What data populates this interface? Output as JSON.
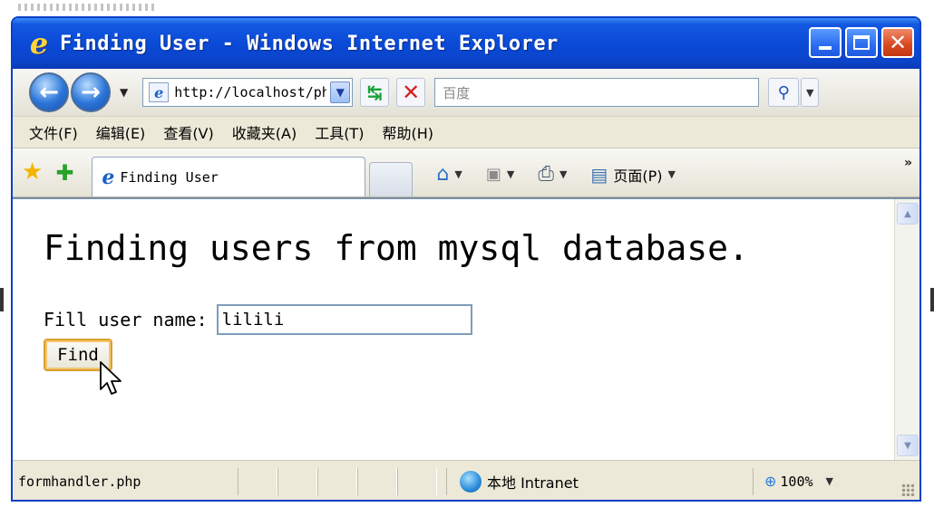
{
  "window": {
    "title": "Finding User - Windows Internet Explorer"
  },
  "navbar": {
    "address": "http://localhost/ph",
    "search_placeholder": "百度"
  },
  "menu": {
    "items": [
      "文件(F)",
      "编辑(E)",
      "查看(V)",
      "收藏夹(A)",
      "工具(T)",
      "帮助(H)"
    ]
  },
  "tabs": {
    "active_label": "Finding User",
    "page_menu": "页面(P)"
  },
  "content": {
    "heading": "Finding users from mysql database.",
    "label": "Fill user name:",
    "input_value": "lilili",
    "button_label": "Find"
  },
  "status": {
    "text": "formhandler.php",
    "zone": "本地 Intranet",
    "zoom": "100%"
  }
}
